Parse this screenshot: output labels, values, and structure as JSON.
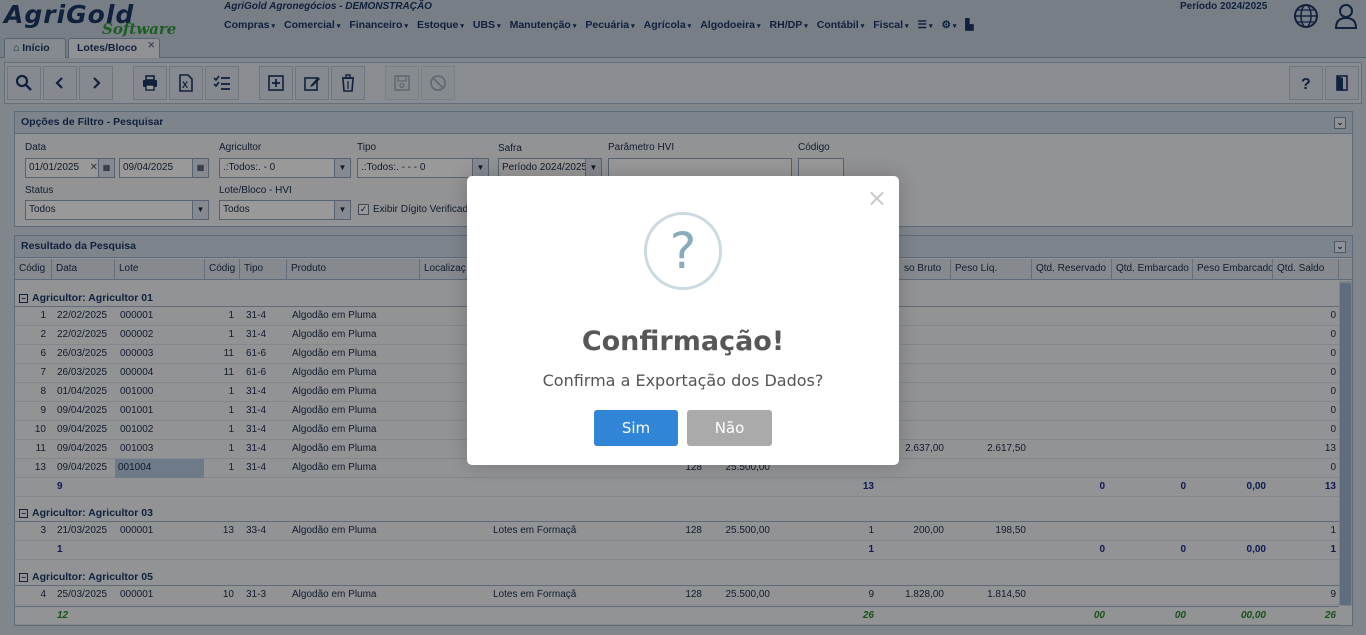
{
  "header": {
    "logo_top": "AgriGold",
    "logo_bottom": "Software",
    "company": "AgriGold Agronegócios - DEMONSTRAÇÃO",
    "periodo": "Período 2024/2025",
    "menu": [
      "Compras",
      "Comercial",
      "Financeiro",
      "Estoque",
      "UBS",
      "Manutenção",
      "Pecuária",
      "Agrícola",
      "Algodoeira",
      "RH/DP",
      "Contábil",
      "Fiscal"
    ]
  },
  "tabs": [
    {
      "label": "Início"
    },
    {
      "label": "Lotes/Bloco"
    }
  ],
  "filter": {
    "title": "Opções de Filtro - Pesquisar",
    "data_label": "Data",
    "data_from": "01/01/2025",
    "data_to": "09/04/2025",
    "agricultor_label": "Agricultor",
    "agricultor_value": ".:Todos:. - 0",
    "tipo_label": "Tipo",
    "tipo_value": ".:Todos:. - - - 0",
    "safra_label": "Safra",
    "safra_value": "Período 2024/2025",
    "hvi_label": "Parâmetro HVI",
    "codigo_label": "Código",
    "status_label": "Status",
    "status_value": "Todos",
    "lote_label": "Lote/Bloco - HVI",
    "lote_value": "Todos",
    "exibir_label": "Exibir Dígito Verificado"
  },
  "results": {
    "title": "Resultado da Pesquisa",
    "columns": [
      "Códig",
      "Data",
      "Lote",
      "Códig",
      "Tipo",
      "Produto",
      "Localizaç",
      "",
      "",
      "",
      "so Bruto",
      "Peso Líq.",
      "Qtd. Reservado",
      "Qtd. Embarcado",
      "Peso Embarcado",
      "Qtd. Saldo"
    ],
    "groups": [
      {
        "label": "Agricultor: Agricultor 01",
        "rows": [
          {
            "cod": "1",
            "data": "22/02/2025",
            "lote": "000001",
            "cod2": "1",
            "tipo": "31-4",
            "produto": "Algodão em Pluma",
            "loc": "",
            "c1": "",
            "c2": "",
            "c3": "",
            "bruto": "",
            "liq": "",
            "saldo": "0"
          },
          {
            "cod": "2",
            "data": "22/02/2025",
            "lote": "000002",
            "cod2": "1",
            "tipo": "31-4",
            "produto": "Algodão em Pluma",
            "loc": "",
            "c1": "",
            "c2": "",
            "c3": "",
            "bruto": "",
            "liq": "",
            "saldo": "0"
          },
          {
            "cod": "6",
            "data": "26/03/2025",
            "lote": "000003",
            "cod2": "11",
            "tipo": "61-6",
            "produto": "Algodão em Pluma",
            "loc": "",
            "c1": "",
            "c2": "",
            "c3": "",
            "bruto": "",
            "liq": "",
            "saldo": "0"
          },
          {
            "cod": "7",
            "data": "26/03/2025",
            "lote": "000004",
            "cod2": "11",
            "tipo": "61-6",
            "produto": "Algodão em Pluma",
            "loc": "",
            "c1": "",
            "c2": "",
            "c3": "",
            "bruto": "",
            "liq": "",
            "saldo": "0"
          },
          {
            "cod": "8",
            "data": "01/04/2025",
            "lote": "001000",
            "cod2": "1",
            "tipo": "31-4",
            "produto": "Algodão em Pluma",
            "loc": "",
            "c1": "",
            "c2": "",
            "c3": "",
            "bruto": "",
            "liq": "",
            "saldo": "0"
          },
          {
            "cod": "9",
            "data": "09/04/2025",
            "lote": "001001",
            "cod2": "1",
            "tipo": "31-4",
            "produto": "Algodão em Pluma",
            "loc": "",
            "c1": "",
            "c2": "",
            "c3": "",
            "bruto": "",
            "liq": "",
            "saldo": "0"
          },
          {
            "cod": "10",
            "data": "09/04/2025",
            "lote": "001002",
            "cod2": "1",
            "tipo": "31-4",
            "produto": "Algodão em Pluma",
            "loc": "",
            "c1": "",
            "c2": "",
            "c3": "",
            "bruto": "",
            "liq": "",
            "saldo": "0"
          },
          {
            "cod": "11",
            "data": "09/04/2025",
            "lote": "001003",
            "cod2": "1",
            "tipo": "31-4",
            "produto": "Algodão em Pluma",
            "loc": "",
            "c1": "",
            "c2": "",
            "c3": "",
            "bruto": "2.637,00",
            "liq": "2.617,50",
            "saldo": "13"
          },
          {
            "cod": "13",
            "data": "09/04/2025",
            "lote": "001004",
            "cod2": "1",
            "tipo": "31-4",
            "produto": "Algodão em Pluma",
            "loc": "",
            "c1": "128",
            "c2": "25.500,00",
            "c3": "",
            "bruto": "",
            "liq": "",
            "saldo": "0"
          }
        ],
        "summary": {
          "count": "9",
          "c3": "13",
          "res": "0",
          "emb": "0",
          "pemb": "0,00",
          "saldo": "13"
        }
      },
      {
        "label": "Agricultor: Agricultor 03",
        "rows": [
          {
            "cod": "3",
            "data": "21/03/2025",
            "lote": "000001",
            "cod2": "13",
            "tipo": "33-4",
            "produto": "Algodão em Pluma",
            "loc": "Lotes em Formaçã",
            "c1": "128",
            "c2": "25.500,00",
            "c3": "1",
            "bruto": "200,00",
            "liq": "198,50",
            "saldo": "1"
          }
        ],
        "summary": {
          "count": "1",
          "c3": "1",
          "res": "0",
          "emb": "0",
          "pemb": "0,00",
          "saldo": "1"
        }
      },
      {
        "label": "Agricultor: Agricultor 05",
        "rows": [
          {
            "cod": "4",
            "data": "25/03/2025",
            "lote": "000001",
            "cod2": "10",
            "tipo": "31-3",
            "produto": "Algodão em Pluma",
            "loc": "Lotes em Formaçã",
            "c1": "128",
            "c2": "25.500,00",
            "c3": "9",
            "bruto": "1.828,00",
            "liq": "1.814,50",
            "saldo": "9"
          }
        ]
      }
    ],
    "grand_total": {
      "count": "12",
      "c3": "26",
      "res": "00",
      "emb": "00",
      "pemb": "00,00",
      "saldo": "26"
    }
  },
  "dialog": {
    "icon": "?",
    "title": "Confirmação!",
    "message": "Confirma a Exportação dos Dados?",
    "yes": "Sim",
    "no": "Não",
    "close": "×"
  }
}
